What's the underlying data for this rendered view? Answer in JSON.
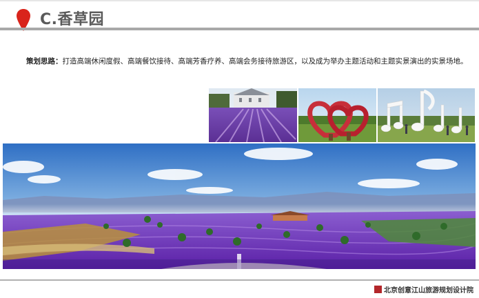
{
  "header": {
    "title": "C.香草园",
    "accent_color": "#d9241b"
  },
  "strategy": {
    "label": "策划思路：",
    "text": "打造高端休闲度假、高端餐饮接待、高端芳香疗养、高端会务接待旅游区，以及成为举办主题活动和主题实景演出的实景场地。"
  },
  "images": {
    "thumb1": "lavender-field-castle-photo",
    "thumb2": "heart-flower-sculpture-photo",
    "thumb3": "music-note-sculpture-photo",
    "panorama": "lavender-garden-panorama-rendering"
  },
  "footer": {
    "company": "北京创意江山旅游规划设计院"
  }
}
